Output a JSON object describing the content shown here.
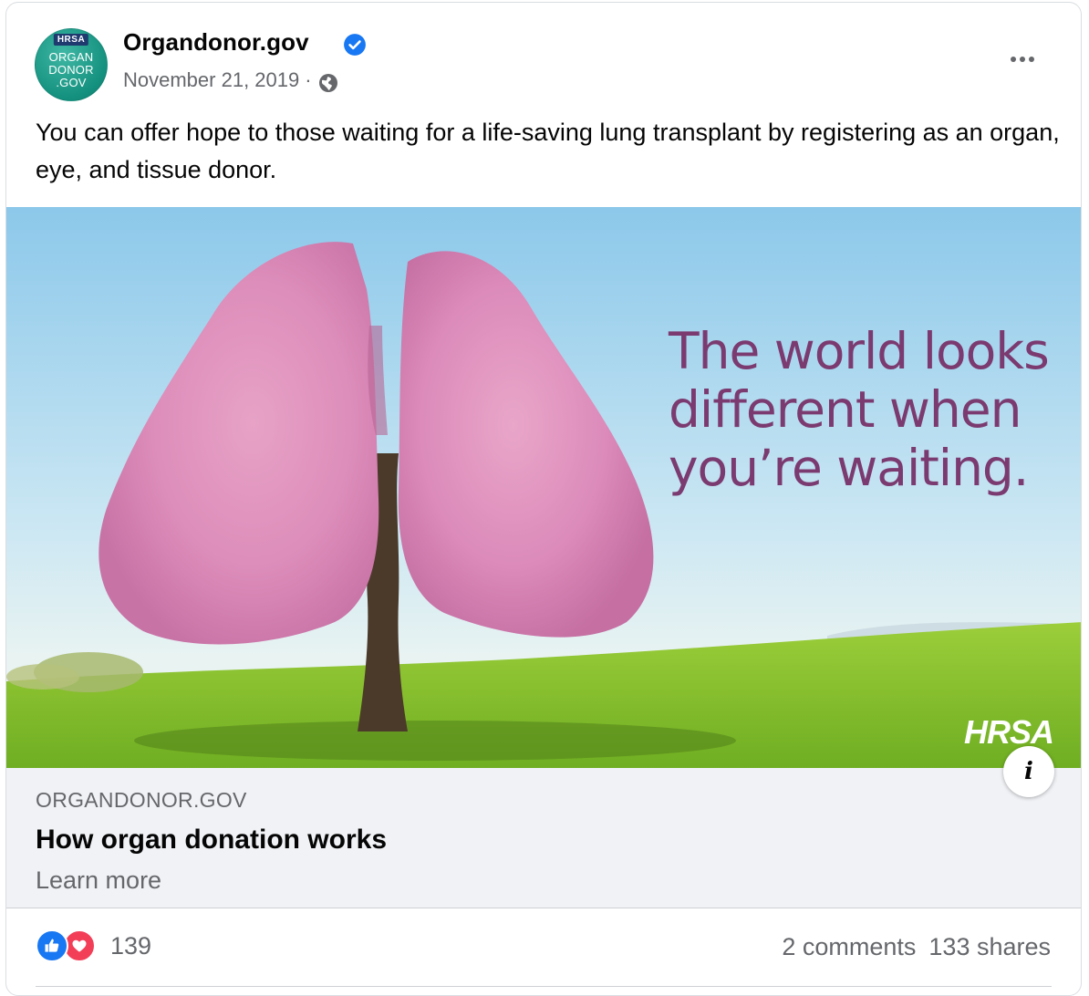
{
  "post": {
    "page_name": "Organdonor.gov",
    "date": "November 21, 2019",
    "separator": "·",
    "text": "You can offer hope to those waiting for a life-saving lung transplant by registering as an organ, eye, and tissue donor.",
    "avatar": {
      "badge": "HRSA",
      "line1": "ORGAN",
      "line2": "DONOR",
      "line3": ".GOV"
    },
    "icons": {
      "verified": "verified-badge-icon",
      "audience": "globe-icon",
      "more": "more-options-icon"
    }
  },
  "link_preview": {
    "image_headline": [
      "The world looks",
      "different when",
      "you’re waiting."
    ],
    "image_logo": "HRSA",
    "domain": "ORGANDONOR.GOV",
    "title": "How organ donation works",
    "subtitle": "Learn more",
    "info_icon": "i"
  },
  "engagement": {
    "reaction_count": "139",
    "comments": "2 comments",
    "shares": "133 shares",
    "reactions": [
      "like-icon",
      "love-icon"
    ]
  },
  "colors": {
    "brand_blue": "#1877f2",
    "love_red": "#f33e58",
    "headline_purple": "#7b3a70",
    "secondary_text": "#65676b",
    "link_footer_bg": "#f0f2f5"
  }
}
